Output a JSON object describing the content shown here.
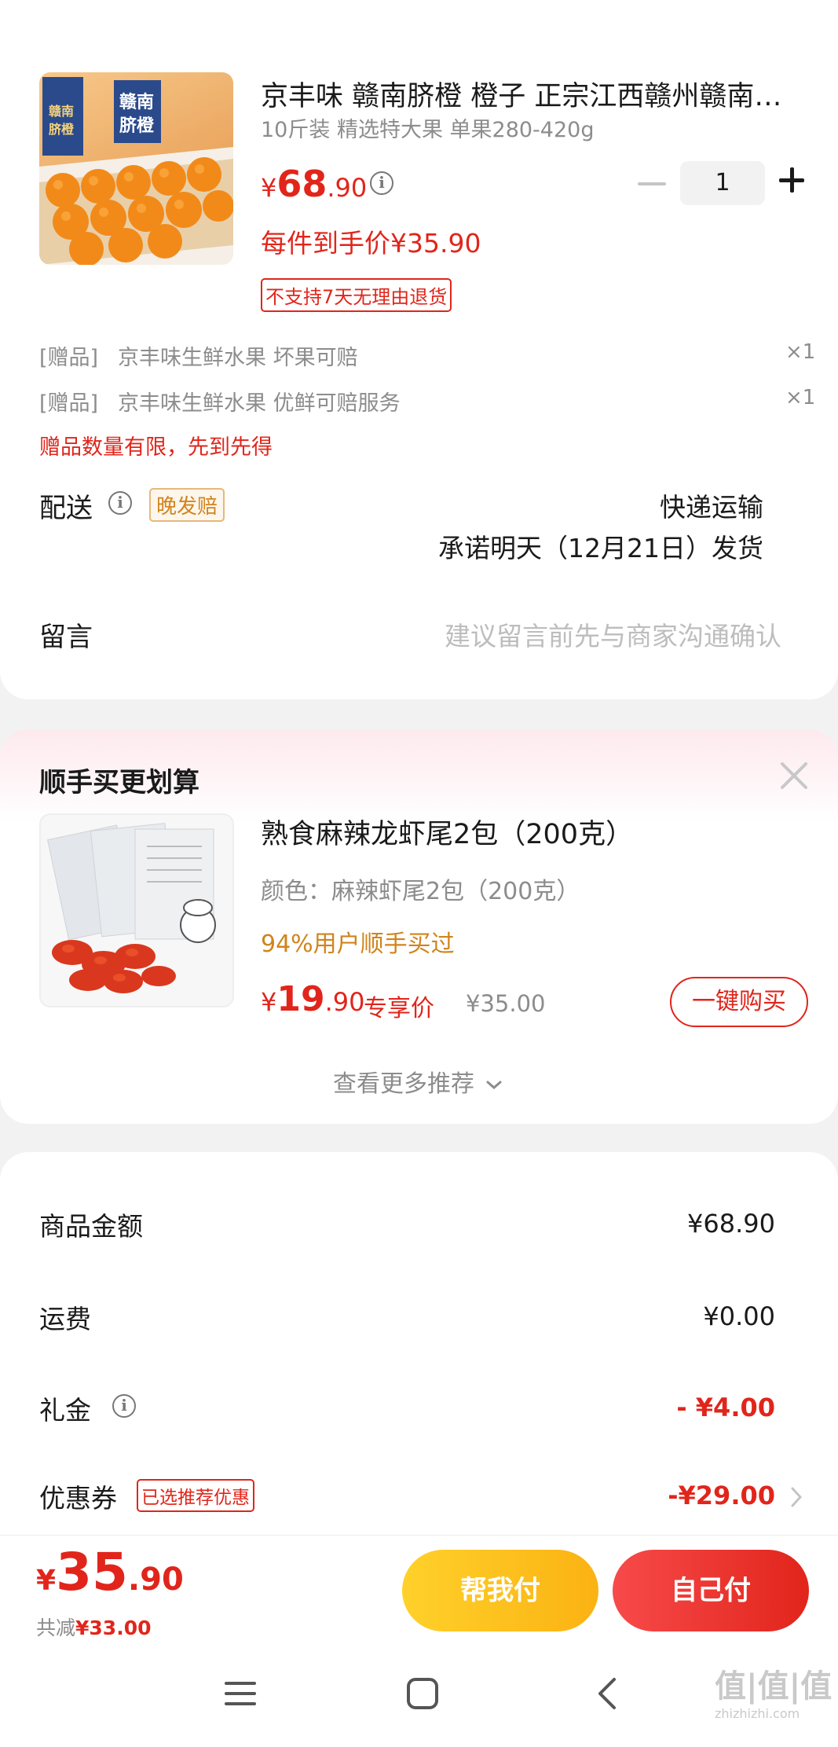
{
  "product": {
    "title": "京丰味 赣南脐橙 橙子 正宗江西赣州赣南…",
    "spec": "10斤装 精选特大果 单果280-420g",
    "price_symbol": "¥",
    "price_int": "68",
    "price_dec": ".90",
    "quantity": "1",
    "final_price_text": "每件到手价¥35.90",
    "return_tag": "不支持7天无理由退货",
    "box_text": "赣南脐橙"
  },
  "gifts": [
    {
      "tag": "[赠品]",
      "name": "京丰味生鲜水果 坏果可赔",
      "qty": "×1"
    },
    {
      "tag": "[赠品]",
      "name": "京丰味生鲜水果 优鲜可赔服务",
      "qty": "×1"
    }
  ],
  "gift_note": "赠品数量有限，先到先得",
  "delivery": {
    "label": "配送",
    "tag": "晚发赔",
    "method": "快递运输",
    "promise": "承诺明天（12月21日）发货"
  },
  "message": {
    "label": "留言",
    "placeholder": "建议留言前先与商家沟通确认"
  },
  "addon": {
    "section_title": "顺手买更划算",
    "name": "熟食麻辣龙虾尾2包（200克）",
    "spec": "颜色：麻辣虾尾2包（200克）",
    "social_proof": "94%用户顺手买过",
    "price_symbol": "¥",
    "price_int": "19",
    "price_dec": ".90",
    "price_label": "专享价",
    "original_price": "¥35.00",
    "buy_label": "一键购买",
    "more_label": "查看更多推荐"
  },
  "summary": {
    "items_label": "商品金额",
    "items_value": "¥68.90",
    "shipping_label": "运费",
    "shipping_value": "¥0.00",
    "gift_label": "礼金",
    "gift_value": "- ¥4.00",
    "coupon_label": "优惠券",
    "coupon_tag": "已选推荐优惠",
    "coupon_value": "-¥29.00"
  },
  "bottom": {
    "price_symbol": "¥",
    "price_int": "35",
    "price_dec": ".90",
    "discount_prefix": "共减",
    "discount_value": "¥33.00",
    "help_pay": "帮我付",
    "self_pay": "自己付"
  },
  "watermark": "值|值|值 zhizhizhi.com",
  "colors": {
    "accent_red": "#e1251b",
    "help_pay_yellow": "#fbb213",
    "orange_tag": "#d1841c",
    "background": "#f2f2f2"
  },
  "icons": [
    "info-icon",
    "close-icon",
    "chevron-down-icon",
    "chevron-right-icon",
    "menu-icon",
    "home-icon",
    "back-icon"
  ]
}
